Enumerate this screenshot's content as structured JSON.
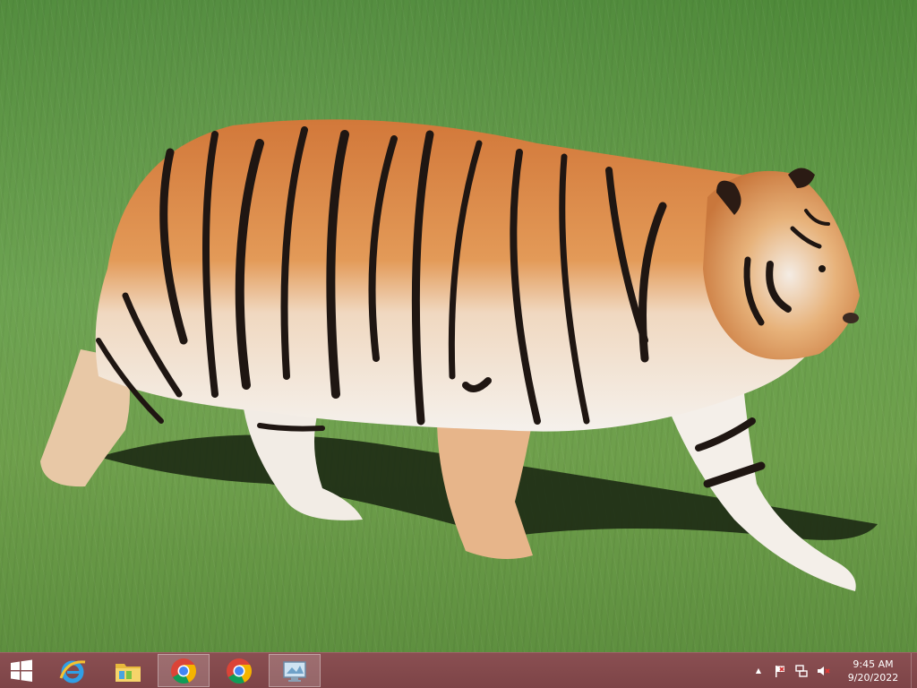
{
  "desktop": {
    "wallpaper": "tiger-walking-on-grass",
    "colors": {
      "grass": "#6aa14e",
      "tiger_orange": "#d98a45",
      "stripe": "#1f1612",
      "white_fur": "#f2eee8"
    }
  },
  "taskbar": {
    "color": "#7d4447",
    "start_icon": "windows-logo-icon",
    "pinned": [
      {
        "name": "internet-explorer",
        "icon": "internet-explorer-icon",
        "active": false
      },
      {
        "name": "file-explorer",
        "icon": "folder-icon",
        "active": false
      },
      {
        "name": "chrome",
        "icon": "chrome-icon",
        "active": true
      },
      {
        "name": "chrome-2",
        "icon": "chrome-icon",
        "active": false
      },
      {
        "name": "control-panel",
        "icon": "monitor-app-icon",
        "active": true
      }
    ],
    "tray": {
      "chevron": "▲",
      "icons": [
        "flag-icon",
        "network-icon",
        "speaker-muted-icon"
      ],
      "time": "9:45 AM",
      "date": "9/20/2022"
    }
  }
}
